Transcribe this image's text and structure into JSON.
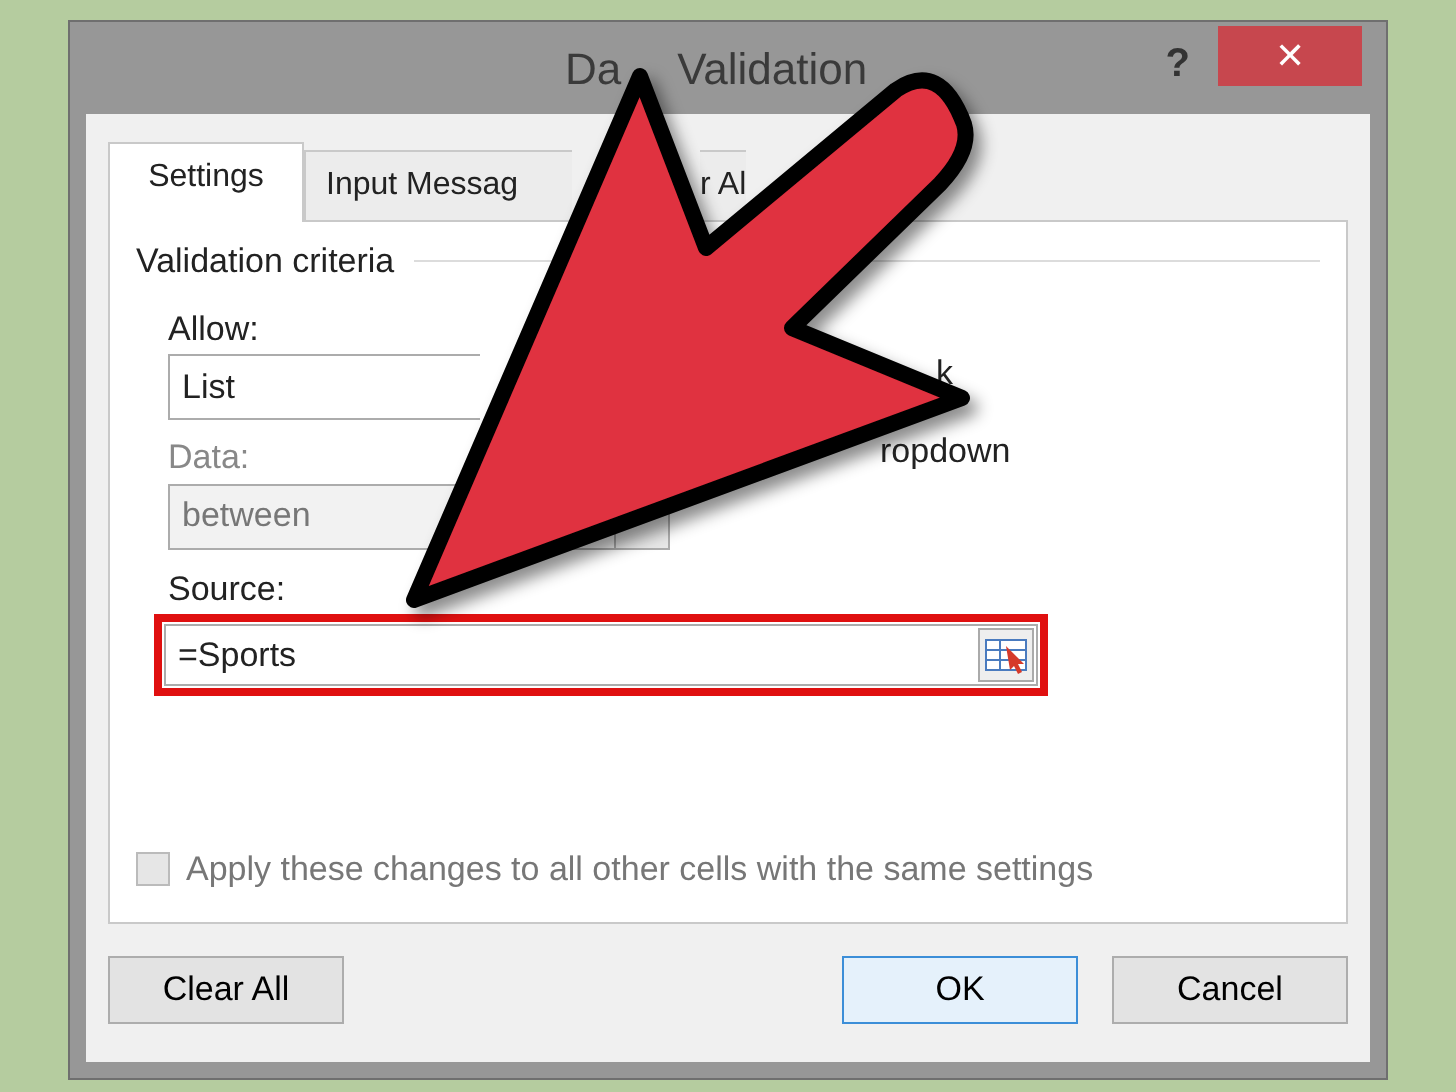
{
  "window": {
    "title_parts": [
      "Da",
      "Validation"
    ],
    "help": "?",
    "close": "✕"
  },
  "tabs": [
    {
      "label": "Settings",
      "selected": true
    },
    {
      "label": "Input Messag",
      "selected": false
    },
    {
      "label": "r Al",
      "selected": false
    }
  ],
  "criteria": {
    "heading": "Validation criteria",
    "allow_label": "Allow:",
    "allow_value": "List",
    "data_label": "Data:",
    "data_disabled": true,
    "data_value": "between",
    "ignore_blank_label": "k",
    "dropdown_label": "ropdown",
    "source_label": "Source:",
    "source_value": "=Sports",
    "source_highlighted": true
  },
  "apply_all": {
    "label": "Apply these changes to all other cells with the same settings",
    "checked": false,
    "disabled": true
  },
  "buttons": [
    {
      "label": "Clear All",
      "kind": "plain"
    },
    {
      "label": "OK",
      "kind": "default"
    },
    {
      "label": "Cancel",
      "kind": "plain"
    }
  ]
}
